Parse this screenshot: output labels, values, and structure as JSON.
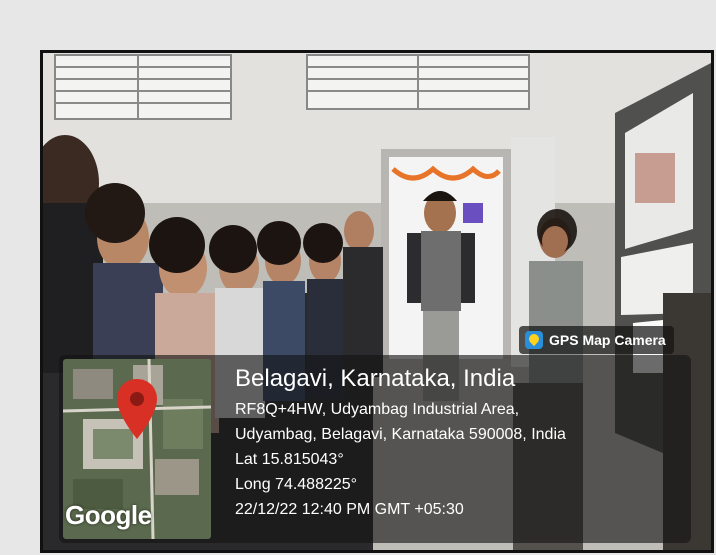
{
  "stamp": {
    "app_name": "GPS Map Camera",
    "app_icon": "gps-map-camera-icon",
    "map_brand": "Google",
    "location_title": "Belagavi, Karnataka, India",
    "address_line_1": "RF8Q+4HW, Udyambag Industrial Area,",
    "address_line_2": "Udyambag, Belagavi, Karnataka 590008, India",
    "latitude": "Lat 15.815043°",
    "longitude": "Long 74.488225°",
    "timestamp": "22/12/22 12:40 PM GMT +05:30"
  },
  "colors": {
    "pin": "#d93025",
    "panel": "rgba(20,20,20,0.62)",
    "frame": "#111111"
  }
}
